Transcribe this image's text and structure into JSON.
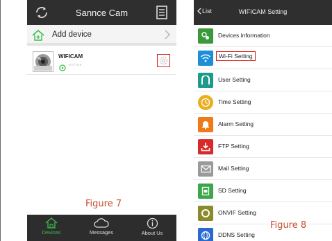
{
  "left_phone": {
    "title": "Sannce Cam",
    "add_device_label": "Add device",
    "camera": {
      "name": "WIFICAM",
      "status": "online"
    },
    "tabs": [
      {
        "label": "Devices",
        "icon": "home-icon",
        "active": true
      },
      {
        "label": "Messages",
        "icon": "cloud-icon",
        "active": false
      },
      {
        "label": "About Us",
        "icon": "info-icon",
        "active": false
      }
    ],
    "figure_label": "Figure 7"
  },
  "right_phone": {
    "back_label": "List",
    "title": "WIFICAM Setting",
    "menu": [
      {
        "label": "Devices information",
        "icon": "puzzle-icon",
        "color": "#3a9a3a"
      },
      {
        "label": "Wi-Fi Setting",
        "icon": "wifi-icon",
        "color": "#1e8fd6",
        "highlighted": true
      },
      {
        "label": "User Setting",
        "icon": "user-icon",
        "color": "#1e9a8a"
      },
      {
        "label": "Time Setting",
        "icon": "clock-icon",
        "color": "#e8b020"
      },
      {
        "label": "Alarm Setting",
        "icon": "bell-icon",
        "color": "#ef7a1a"
      },
      {
        "label": "FTP Setting",
        "icon": "download-icon",
        "color": "#d82a2a"
      },
      {
        "label": "Mail Setting",
        "icon": "mail-icon",
        "color": "#9a9a9a"
      },
      {
        "label": "SD Setting",
        "icon": "sd-card-icon",
        "color": "#3aa84a"
      },
      {
        "label": "ONVIF Setting",
        "icon": "ring-icon",
        "color": "#8a8a2a"
      },
      {
        "label": "DDNS Setting",
        "icon": "globe-icon",
        "color": "#2a6ad0"
      }
    ],
    "figure_label": "Figure 8"
  },
  "colors": {
    "topbar": "#2f2f2f",
    "active_tab": "#3bbf4c",
    "highlight": "#d92020",
    "caption": "#c84a2e"
  }
}
